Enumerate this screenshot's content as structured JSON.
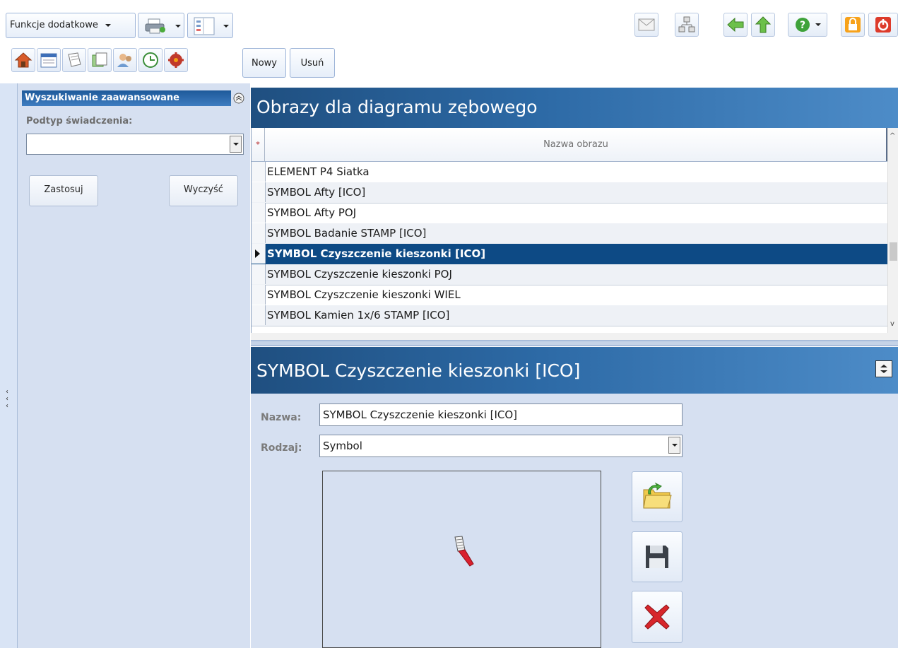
{
  "toolbar": {
    "extra_functions_label": "Funkcje dodatkowe",
    "new_label": "Nowy",
    "delete_label": "Usuń",
    "nav_icons": [
      "home-icon",
      "calendar-icon",
      "register-icon",
      "documents-icon",
      "patients-icon",
      "schedule-icon",
      "settings-icon"
    ],
    "right_icons": [
      "mail-icon",
      "network-icon",
      "back-arrow-icon",
      "up-arrow-icon",
      "help-icon",
      "lock-icon",
      "power-icon"
    ]
  },
  "search": {
    "title": "Wyszukiwanie zaawansowane",
    "subtype_label": "Podtyp świadczenia:",
    "subtype_value": "",
    "apply_label": "Zastosuj",
    "clear_label": "Wyczyść"
  },
  "list": {
    "title": "Obrazy dla diagramu zębowego",
    "column_header": "Nazwa obrazu",
    "rows": [
      "ELEMENT P4 Siatka",
      "SYMBOL Afty [ICO]",
      "SYMBOL Afty POJ",
      "SYMBOL Badanie STAMP [ICO]",
      "SYMBOL Czyszczenie kieszonki [ICO]",
      "SYMBOL Czyszczenie kieszonki POJ",
      "SYMBOL Czyszczenie kieszonki WIEL",
      "SYMBOL Kamien 1x/6 STAMP [ICO]"
    ],
    "selected_index": 4
  },
  "detail": {
    "title": "SYMBOL Czyszczenie kieszonki [ICO]",
    "name_label": "Nazwa:",
    "name_value": "SYMBOL Czyszczenie kieszonki [ICO]",
    "type_label": "Rodzaj:",
    "type_value": "Symbol",
    "preview_icon": "toothbrush-icon"
  },
  "colors": {
    "header_dark": "#1f4f80",
    "selected_row": "#0d4a85",
    "panel_bg": "#d6e0f1"
  }
}
